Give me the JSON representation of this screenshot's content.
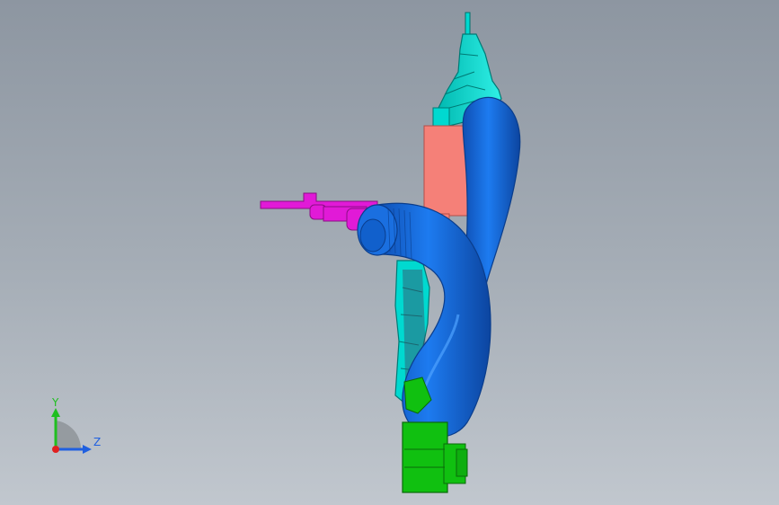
{
  "colors": {
    "background_top": "#8d96a1",
    "background_bottom": "#c1c7ce",
    "cable": "#1a6fe0",
    "cable_dark": "#0f4fb3",
    "bracket": "#00d9d0",
    "bracket_dark": "#009a94",
    "salmon_block": "#f58078",
    "magenta_clip": "#e11ad7",
    "connector": "#10c010",
    "connector_dark": "#0a8a0a"
  },
  "triad": {
    "y_label": "Y",
    "z_label": "Z",
    "y_color": "#1fbf1f",
    "z_color": "#2060e0",
    "x_color": "#e02020"
  }
}
